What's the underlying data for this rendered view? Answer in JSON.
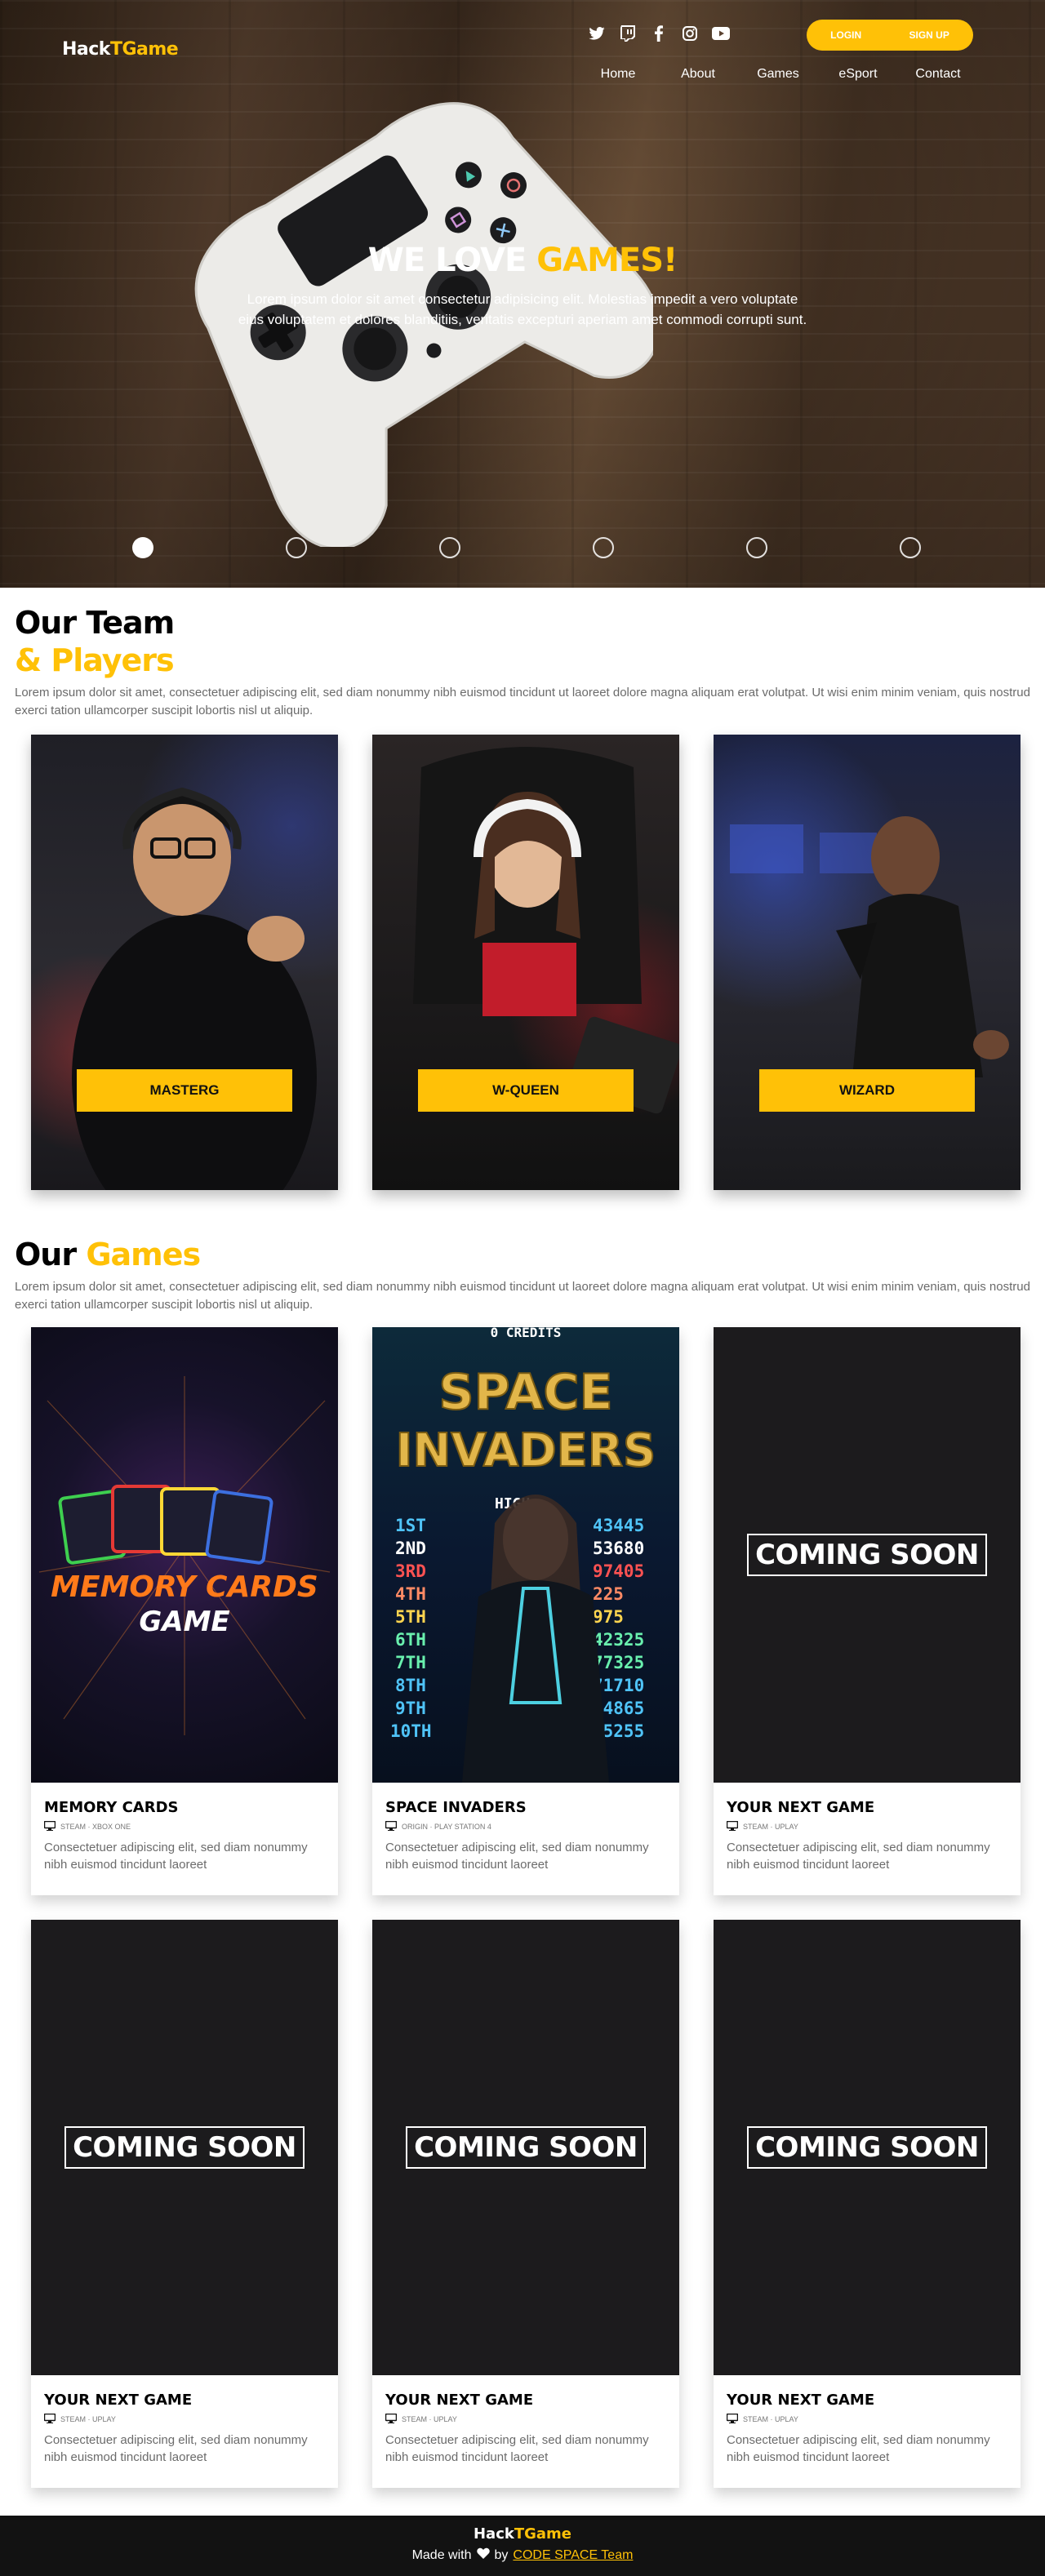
{
  "header": {
    "logo_part1": "Hack",
    "logo_part2": "TGame",
    "social_icons": [
      "twitter-icon",
      "twitch-icon",
      "facebook-icon",
      "instagram-icon",
      "youtube-icon"
    ],
    "login_label": "LOGIN",
    "signup_label": "SIGN UP",
    "nav": [
      "Home",
      "About",
      "Games",
      "eSport",
      "Contact"
    ]
  },
  "hero": {
    "title_part1": "WE LOVE ",
    "title_part2": "GAMES!",
    "description": "Lorem ipsum dolor sit amet consectetur adipisicing elit. Molestias impedit a vero voluptate eius voluptatem et dolores blanditiis, veritatis excepturi aperiam amet commodi corrupti sunt.",
    "slides": 6,
    "active_slide": 1
  },
  "team": {
    "title_line1": "Our Team",
    "title_line2": "& Players",
    "description": "Lorem ipsum dolor sit amet, consectetuer adipiscing elit, sed diam nonummy nibh euismod tincidunt ut laoreet dolore magna aliquam erat volutpat. Ut wisi enim minim veniam, quis nostrud exerci tation ullamcorper suscipit lobortis nisl ut aliquip.",
    "players": [
      {
        "name": "MASTERG"
      },
      {
        "name": "W-QUEEN"
      },
      {
        "name": "WIZARD"
      }
    ]
  },
  "games": {
    "title_part1": "Our ",
    "title_part2": "Games",
    "description": "Lorem ipsum dolor sit amet, consectetuer adipiscing elit, sed diam nonummy nibh euismod tincidunt ut laoreet dolore magna aliquam erat volutpat. Ut wisi enim minim veniam, quis nostrud exerci tation ullamcorper suscipit lobortis nisl ut aliquip.",
    "cards": [
      {
        "title": "MEMORY CARDS",
        "platform": "STEAM · XBOX ONE",
        "description": "Consectetuer adipiscing elit, sed diam nonummy nibh euismod tincidunt laoreet",
        "image": "memory-cards"
      },
      {
        "title": "SPACE INVADERS",
        "platform": "ORIGIN · PLAY STATION 4",
        "description": "Consectetuer adipiscing elit, sed diam nonummy nibh euismod tincidunt laoreet",
        "image": "space-invaders"
      },
      {
        "title": "YOUR NEXT GAME",
        "platform": "STEAM · UPLAY",
        "description": "Consectetuer adipiscing elit, sed diam nonummy nibh euismod tincidunt laoreet",
        "image": "coming-soon"
      },
      {
        "title": "YOUR NEXT GAME",
        "platform": "STEAM · UPLAY",
        "description": "Consectetuer adipiscing elit, sed diam nonummy nibh euismod tincidunt laoreet",
        "image": "coming-soon"
      },
      {
        "title": "YOUR NEXT GAME",
        "platform": "STEAM · UPLAY",
        "description": "Consectetuer adipiscing elit, sed diam nonummy nibh euismod tincidunt laoreet",
        "image": "coming-soon"
      },
      {
        "title": "YOUR NEXT GAME",
        "platform": "STEAM · UPLAY",
        "description": "Consectetuer adipiscing elit, sed diam nonummy nibh euismod tincidunt laoreet",
        "image": "coming-soon"
      }
    ],
    "coming_soon_label": "COMING SOON",
    "memory_cards_line1": "MEMORY CARDS",
    "memory_cards_line2": "GAME",
    "space_invaders_logo": "SPACE INVADERS",
    "space_invaders_credits": "0 CREDITS",
    "space_invaders_scores": [
      {
        "rank": "1ST",
        "score": "43445"
      },
      {
        "rank": "2ND",
        "score": "53680"
      },
      {
        "rank": "3RD",
        "score": "97405"
      },
      {
        "rank": "4TH",
        "score": "225"
      },
      {
        "rank": "5TH",
        "score": "975"
      },
      {
        "rank": "6TH",
        "score": "42325"
      },
      {
        "rank": "7TH",
        "score": "77325"
      },
      {
        "rank": "8TH",
        "score": "71710"
      },
      {
        "rank": "9TH",
        "score": "04865"
      },
      {
        "rank": "10TH",
        "score": "65255"
      }
    ],
    "space_invaders_high": "HIGH"
  },
  "footer": {
    "logo_part1": "Hack",
    "logo_part2": "TGame",
    "made_with": "Made with",
    "by": "by",
    "team_link": "CODE SPACE Team"
  },
  "colors": {
    "accent": "#ffc107",
    "dark": "#121212",
    "card_dark": "#1c1b1d"
  }
}
